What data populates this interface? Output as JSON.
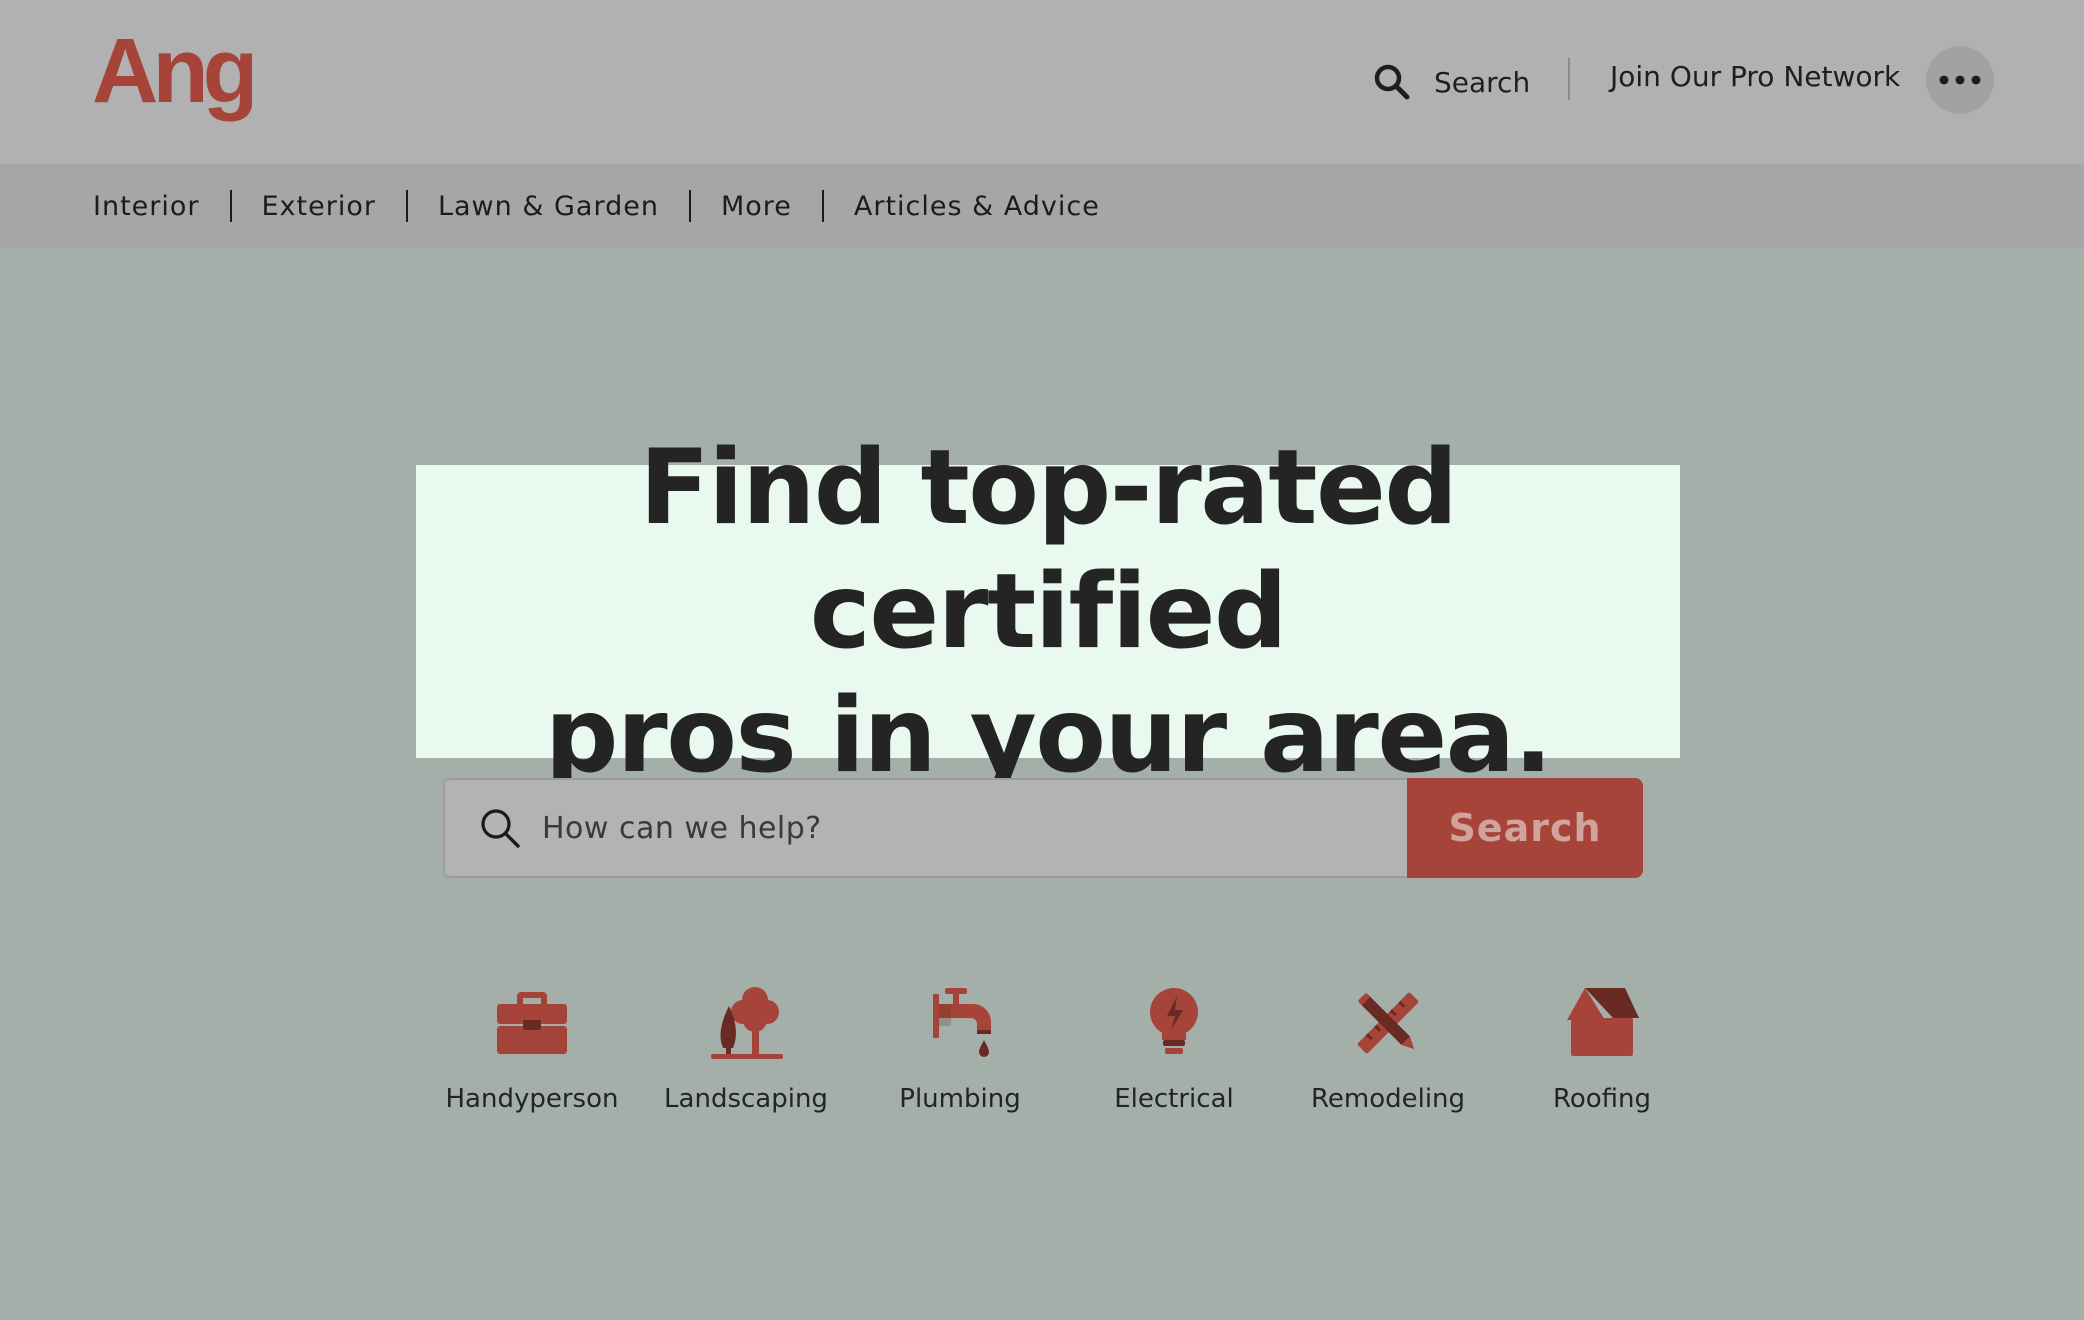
{
  "brand": {
    "name": "Angi",
    "color": "#a64439"
  },
  "header": {
    "search_label": "Search",
    "join_label": "Join Our Pro Network",
    "more_icon": "ellipsis-icon"
  },
  "subnav": {
    "items": [
      "Interior",
      "Exterior",
      "Lawn & Garden",
      "More",
      "Articles & Advice"
    ]
  },
  "hero": {
    "headline_line1": "Find top-rated certified",
    "headline_line2": "pros in your area.",
    "search_placeholder": "How can we help?",
    "search_button": "Search"
  },
  "categories": [
    {
      "label": "Handyperson",
      "icon": "toolbox-icon"
    },
    {
      "label": "Landscaping",
      "icon": "tree-icon"
    },
    {
      "label": "Plumbing",
      "icon": "faucet-icon"
    },
    {
      "label": "Electrical",
      "icon": "lightbulb-icon"
    },
    {
      "label": "Remodeling",
      "icon": "pencil-ruler-icon"
    },
    {
      "label": "Roofing",
      "icon": "house-roof-icon"
    }
  ]
}
